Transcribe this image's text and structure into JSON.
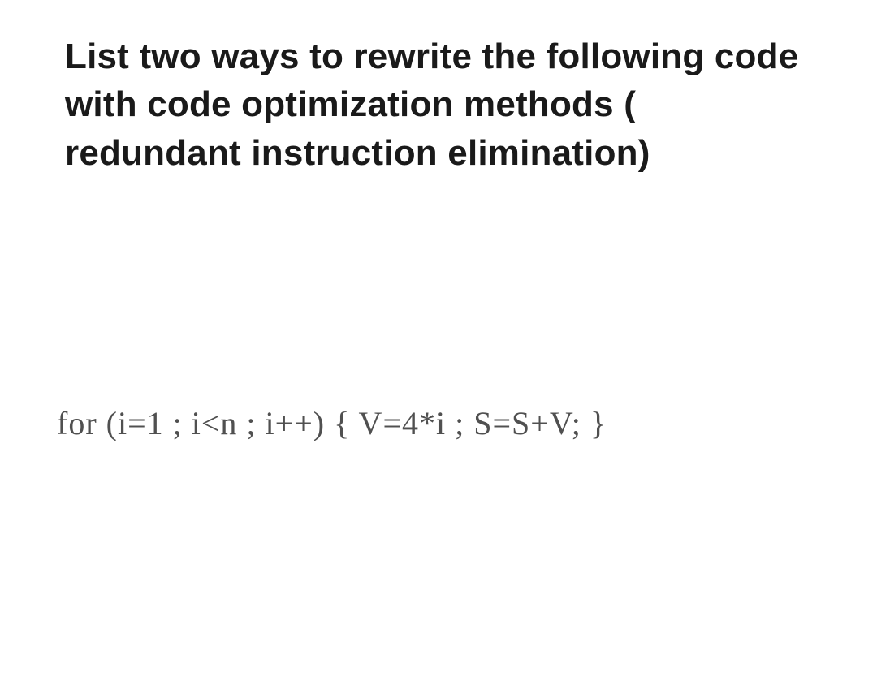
{
  "question": {
    "text": "List two ways to rewrite the following code with code optimization methods ( redundant instruction elimination)"
  },
  "code": {
    "text": "for (i=1 ; i<n ; i++) { V=4*i ; S=S+V; }"
  }
}
